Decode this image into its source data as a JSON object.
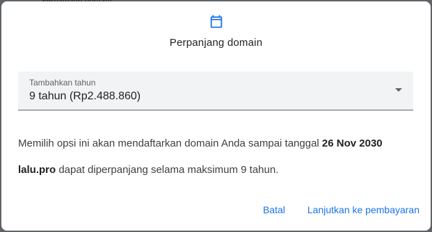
{
  "backdrop": {
    "text": "Perpanjang domain"
  },
  "dialog": {
    "icon": "calendar-icon",
    "title": "Perpanjang domain",
    "select": {
      "label": "Tambahkan tahun",
      "value": "9 tahun (Rp2.488.860)"
    },
    "message": {
      "prefix": "Memilih opsi ini akan mendaftarkan domain Anda sampai tanggal ",
      "date": "26 Nov 2030"
    },
    "max_info": {
      "domain": "lalu.pro",
      "suffix": " dapat diperpanjang selama maksimum 9 tahun."
    },
    "actions": {
      "cancel": "Batal",
      "continue": "Lanjutkan ke pembayaran"
    }
  },
  "colors": {
    "accent": "#1a73e8",
    "overlay": "#5f6368",
    "field_bg": "#f1f3f4"
  }
}
